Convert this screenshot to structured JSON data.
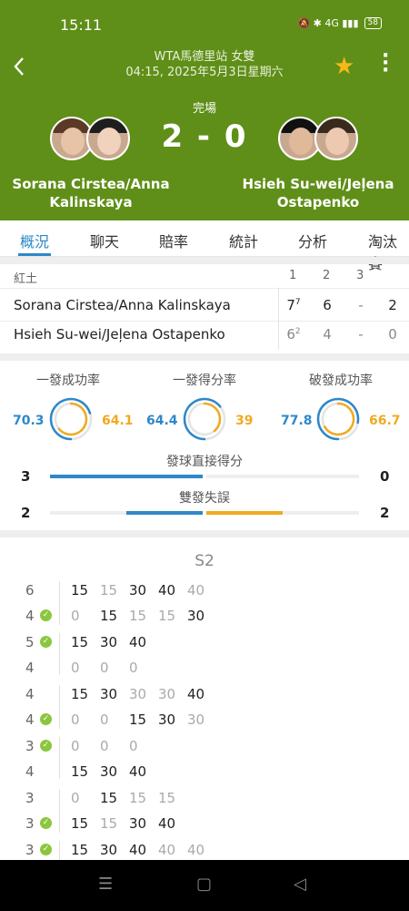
{
  "status_bar": {
    "time": "15:11",
    "icons": "🔕 ✱ 4G ▮▮▮",
    "battery": "58"
  },
  "header": {
    "back_icon": "chevron-left-icon",
    "tournament": "WTA馬德里站 女雙",
    "datetime": "04:15, 2025年5月3日星期六",
    "status": "完場",
    "score": "2 - 0",
    "home_team": "Sorana Cirstea/Anna Kalinskaya",
    "away_team": "Hsieh Su-wei/Jeļena Ostapenko",
    "favorite_icon": "star-icon",
    "accent": "#5f8f18"
  },
  "tabs": [
    {
      "label": "概況",
      "active": true
    },
    {
      "label": "聊天"
    },
    {
      "label": "賠率"
    },
    {
      "label": "統計"
    },
    {
      "label": "分析"
    },
    {
      "label": "淘汰賽"
    }
  ],
  "sets_table": {
    "surface": "紅土",
    "columns": [
      "1",
      "2",
      "3"
    ],
    "rows": [
      {
        "name": "Sorana Cirstea/Anna Kalinskaya",
        "s1": "7",
        "s1_tb": "7",
        "s2": "6",
        "s3": "-",
        "total": "2"
      },
      {
        "name": "Hsieh Su-wei/Jeļena Ostapenko",
        "s1": "6",
        "s1_tb": "2",
        "s2": "4",
        "s3": "-",
        "total": "0"
      }
    ]
  },
  "stats": {
    "circles": [
      {
        "label": "一發成功率",
        "left": "70.3",
        "right": "64.1",
        "left_value": 70.3,
        "right_value": 64.1
      },
      {
        "label": "一發得分率",
        "left": "64.4",
        "right": "39",
        "left_value": 64.4,
        "right_value": 39
      },
      {
        "label": "破發成功率",
        "left": "77.8",
        "right": "66.7",
        "left_value": 77.8,
        "right_value": 66.7
      }
    ],
    "bars": [
      {
        "label": "發球直接得分",
        "left": "3",
        "right": "0",
        "left_value": 3,
        "right_value": 0
      },
      {
        "label": "雙發失誤",
        "left": "2",
        "right": "2",
        "left_value": 2,
        "right_value": 2
      }
    ],
    "blue": "#2d88c9",
    "orange": "#f0aa20"
  },
  "point_by_point": {
    "set_title": "S2",
    "rows": [
      {
        "games": "6",
        "check": false,
        "points": [
          [
            "15",
            "w"
          ],
          [
            "15",
            "l"
          ],
          [
            "30",
            "w"
          ],
          [
            "40",
            "w"
          ],
          [
            "40",
            "l"
          ]
        ]
      },
      {
        "games": "4",
        "check": true,
        "points": [
          [
            "0",
            "l"
          ],
          [
            "15",
            "w"
          ],
          [
            "15",
            "l"
          ],
          [
            "15",
            "l"
          ],
          [
            "30",
            "w"
          ]
        ]
      },
      {
        "games": "5",
        "check": true,
        "points": [
          [
            "15",
            "w"
          ],
          [
            "30",
            "w"
          ],
          [
            "40",
            "w"
          ]
        ]
      },
      {
        "games": "4",
        "check": false,
        "points": [
          [
            "0",
            "l"
          ],
          [
            "0",
            "l"
          ],
          [
            "0",
            "l"
          ]
        ]
      },
      {
        "games": "4",
        "check": false,
        "points": [
          [
            "15",
            "w"
          ],
          [
            "30",
            "w"
          ],
          [
            "30",
            "l"
          ],
          [
            "30",
            "l"
          ],
          [
            "40",
            "w"
          ]
        ]
      },
      {
        "games": "4",
        "check": true,
        "points": [
          [
            "0",
            "l"
          ],
          [
            "0",
            "l"
          ],
          [
            "15",
            "w"
          ],
          [
            "30",
            "w"
          ],
          [
            "30",
            "l"
          ]
        ]
      },
      {
        "games": "3",
        "check": true,
        "points": [
          [
            "0",
            "l"
          ],
          [
            "0",
            "l"
          ],
          [
            "0",
            "l"
          ]
        ]
      },
      {
        "games": "4",
        "check": false,
        "points": [
          [
            "15",
            "w"
          ],
          [
            "30",
            "w"
          ],
          [
            "40",
            "w"
          ]
        ]
      },
      {
        "games": "3",
        "check": false,
        "points": [
          [
            "0",
            "l"
          ],
          [
            "15",
            "w"
          ],
          [
            "15",
            "l"
          ],
          [
            "15",
            "l"
          ]
        ]
      },
      {
        "games": "3",
        "check": true,
        "points": [
          [
            "15",
            "w"
          ],
          [
            "15",
            "l"
          ],
          [
            "30",
            "w"
          ],
          [
            "40",
            "w"
          ]
        ]
      },
      {
        "games": "3",
        "check": true,
        "points": [
          [
            "15",
            "w"
          ],
          [
            "30",
            "w"
          ],
          [
            "40",
            "w"
          ],
          [
            "40",
            "l"
          ],
          [
            "40",
            "l"
          ]
        ]
      }
    ]
  },
  "nav": {
    "menu_icon": "☰",
    "home_icon": "▢",
    "back_icon": "◁"
  }
}
